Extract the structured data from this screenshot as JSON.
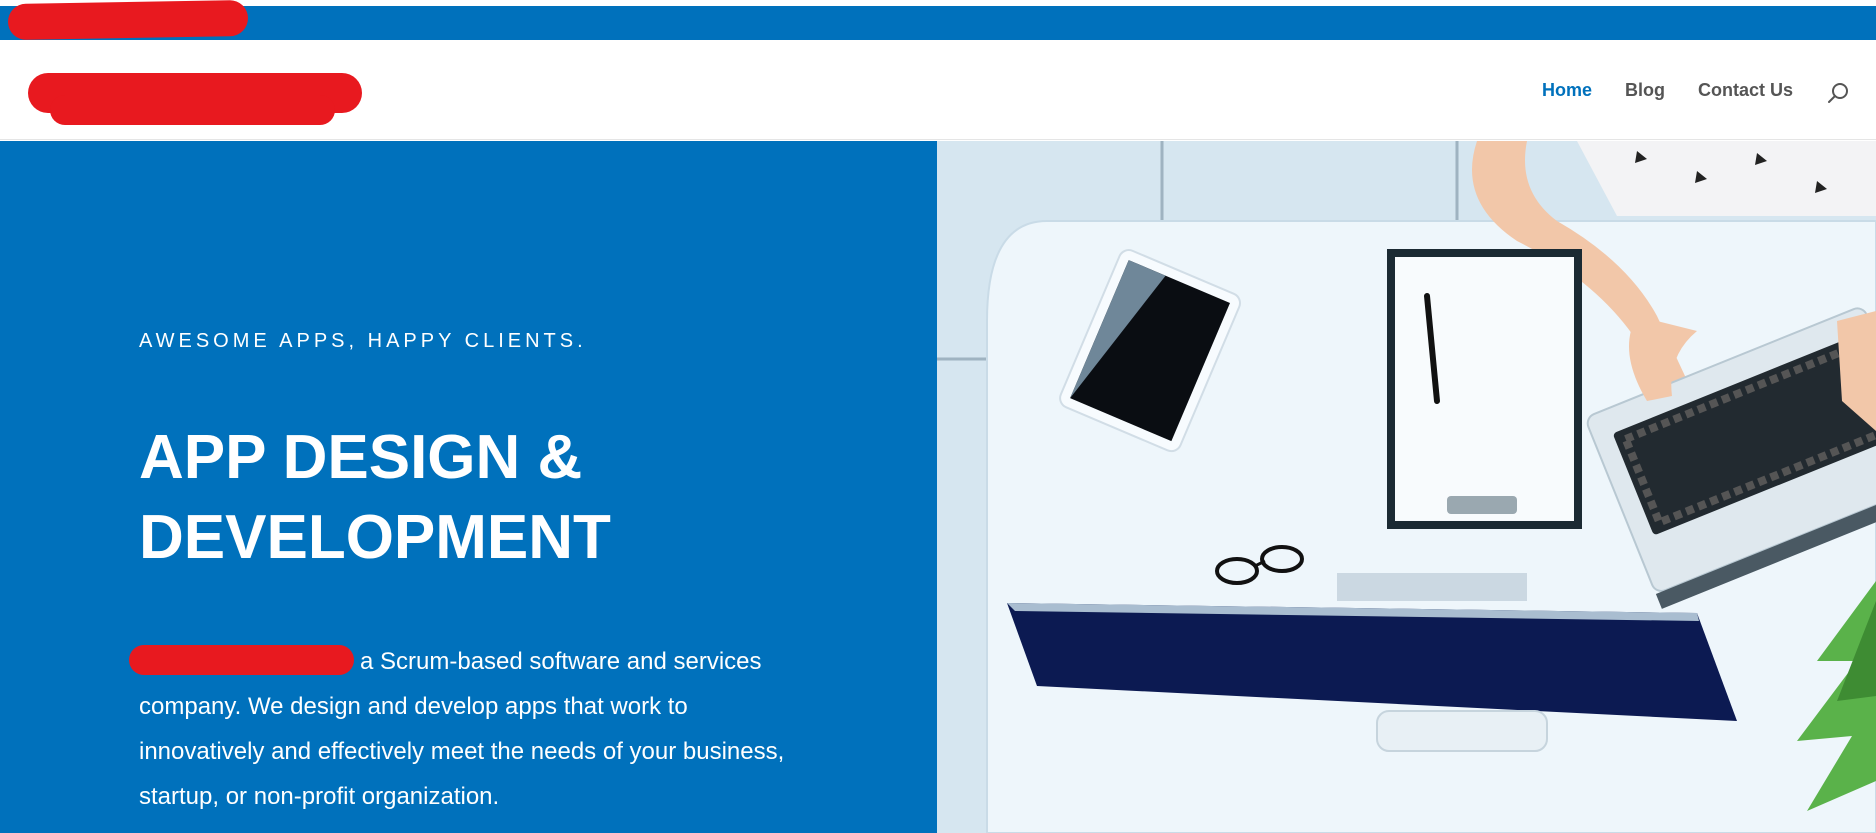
{
  "header": {
    "nav": [
      {
        "label": "Home",
        "active": true
      },
      {
        "label": "Blog",
        "active": false
      },
      {
        "label": "Contact Us",
        "active": false
      }
    ],
    "search_icon": "search-icon"
  },
  "hero": {
    "eyebrow": "AWESOME APPS, HAPPY CLIENTS.",
    "headline_line1": "APP DESIGN &",
    "headline_line2": "DEVELOPMENT",
    "body": "a Scrum-based software and services company. We design and develop apps that work to innovatively and effectively meet the needs of your business, startup, or non-profit organization.",
    "image": "office-desk-photo"
  },
  "colors": {
    "brand_blue": "#0071bc",
    "redaction_red": "#e8191f",
    "nav_text": "#555555"
  }
}
